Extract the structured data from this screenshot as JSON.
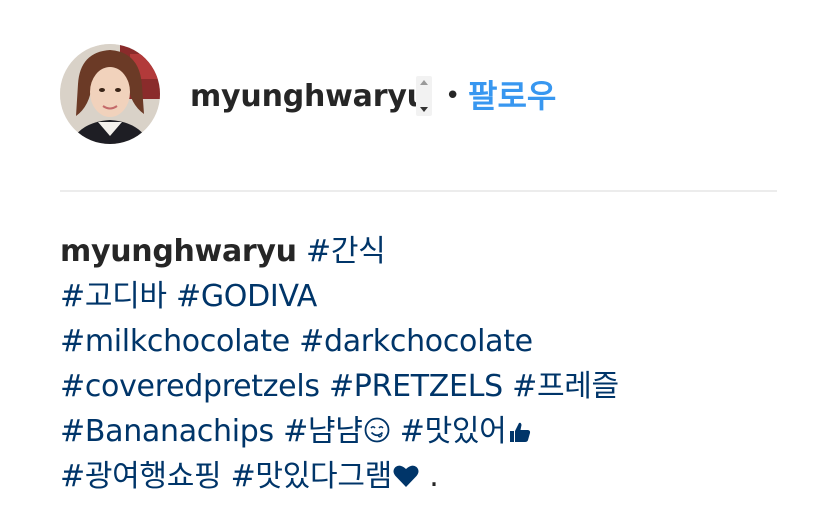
{
  "post_header": {
    "username": "myunghwaryu",
    "separator": "•",
    "follow_label": "팔로우"
  },
  "caption": {
    "username": "myunghwaryu",
    "lines": [
      [
        "#간식"
      ],
      [
        "#고디바",
        "#GODIVA"
      ],
      [
        "#milkchocolate",
        "#darkchocolate"
      ],
      [
        "#coveredpretzels",
        "#PRETZELS",
        "#프레즐"
      ],
      [
        "#Bananachips",
        "#냠냠",
        "#맛있어"
      ],
      [
        "#광여행쇼핑",
        "#맛있다그램"
      ]
    ],
    "trailing": "."
  },
  "icons": {
    "yum_emoji": "yum-face-icon",
    "thumbs_up_emoji": "thumbs-up-icon",
    "heart_emoji": "heart-icon"
  },
  "colors": {
    "hashtag": "#003569",
    "follow": "#3897f0",
    "username": "#262626",
    "divider": "#ececec"
  }
}
